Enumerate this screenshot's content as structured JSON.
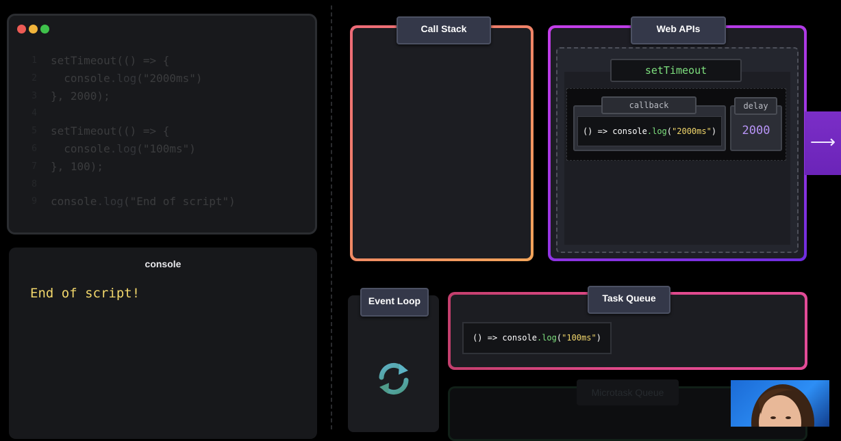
{
  "editor": {
    "window_controls": [
      "close",
      "minimize",
      "maximize"
    ],
    "lines": [
      {
        "n": "1",
        "indent": "",
        "parts": [
          {
            "t": "setTimeout(() => {",
            "c": "plain"
          }
        ]
      },
      {
        "n": "2",
        "indent": "  ",
        "parts": [
          {
            "t": "console",
            "c": "plain"
          },
          {
            "t": ".log",
            "c": "fn"
          },
          {
            "t": "(\"2000ms\")",
            "c": "plain"
          }
        ]
      },
      {
        "n": "3",
        "indent": "",
        "parts": [
          {
            "t": "}, 2000);",
            "c": "plain"
          }
        ]
      },
      {
        "n": "4",
        "indent": "",
        "parts": []
      },
      {
        "n": "5",
        "indent": "",
        "parts": [
          {
            "t": "setTimeout(() => {",
            "c": "plain"
          }
        ]
      },
      {
        "n": "6",
        "indent": "  ",
        "parts": [
          {
            "t": "console",
            "c": "plain"
          },
          {
            "t": ".log",
            "c": "fn"
          },
          {
            "t": "(\"100ms\")",
            "c": "plain"
          }
        ]
      },
      {
        "n": "7",
        "indent": "",
        "parts": [
          {
            "t": "}, 100);",
            "c": "plain"
          }
        ]
      },
      {
        "n": "8",
        "indent": "",
        "parts": []
      },
      {
        "n": "9",
        "indent": "",
        "parts": [
          {
            "t": "console",
            "c": "plain"
          },
          {
            "t": ".log",
            "c": "fn"
          },
          {
            "t": "(\"End of script\")",
            "c": "plain"
          }
        ]
      }
    ]
  },
  "console": {
    "title": "console",
    "output": "End of script!"
  },
  "call_stack": {
    "label": "Call Stack"
  },
  "web_apis": {
    "label": "Web APIs",
    "timer_label": "setTimeout",
    "callback_label": "callback",
    "callback_pre": "() => console",
    "callback_fn": ".log",
    "callback_open": "(",
    "callback_arg": "\"2000ms\"",
    "callback_close": ")",
    "delay_label": "delay",
    "delay_value": "2000",
    "arrow_glyph": "⟶"
  },
  "event_loop": {
    "label": "Event Loop",
    "icon": "refresh-cycle-icon"
  },
  "task_queue": {
    "label": "Task Queue",
    "item_pre": "() => console",
    "item_fn": ".log",
    "item_open": "(",
    "item_arg": "\"100ms\"",
    "item_close": ")"
  },
  "microtask_queue": {
    "label": "Microtask Queue"
  },
  "colors": {
    "call_stack_gradient": [
      "#ee6a78",
      "#f3a55a"
    ],
    "web_apis_gradient": [
      "#c43ee8",
      "#6e2de0"
    ],
    "task_queue_gradient": [
      "#c33f6d",
      "#e24b97"
    ],
    "string_yellow": "#f1d66b",
    "function_green": "#7ee07e",
    "number_purple": "#b794f6"
  }
}
